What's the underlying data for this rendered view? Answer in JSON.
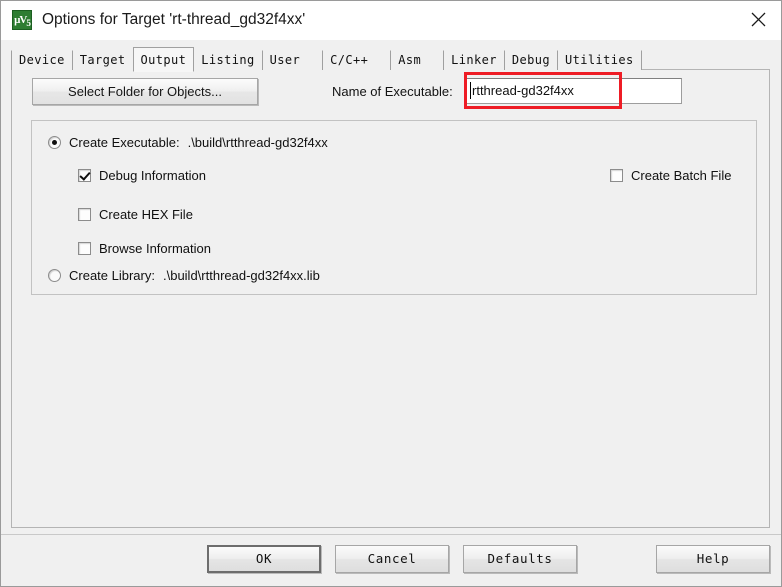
{
  "window": {
    "title": "Options for Target 'rt-thread_gd32f4xx'",
    "icon": "uvision-logo-icon",
    "close_label": "✕"
  },
  "tabs": [
    {
      "label": "Device",
      "selected": false
    },
    {
      "label": "Target",
      "selected": false
    },
    {
      "label": "Output",
      "selected": true
    },
    {
      "label": "Listing",
      "selected": false
    },
    {
      "label": "User",
      "selected": false
    },
    {
      "label": "C/C++",
      "selected": false
    },
    {
      "label": "Asm",
      "selected": false
    },
    {
      "label": "Linker",
      "selected": false
    },
    {
      "label": "Debug",
      "selected": false
    },
    {
      "label": "Utilities",
      "selected": false
    }
  ],
  "output_page": {
    "select_folder_button": "Select Folder for Objects...",
    "name_of_executable_label": "Name of Executable:",
    "name_of_executable_value": "rtthread-gd32f4xx",
    "highlight_color": "#ee1c25",
    "options": {
      "create_executable": {
        "label": "Create Executable:",
        "path": ".\\build\\rtthread-gd32f4xx",
        "checked": true
      },
      "debug_information": {
        "label": "Debug Information",
        "checked": true
      },
      "create_hex_file": {
        "label": "Create HEX File",
        "checked": false
      },
      "browse_information": {
        "label": "Browse Information",
        "checked": false
      },
      "create_batch_file": {
        "label": "Create Batch File",
        "checked": false
      },
      "create_library": {
        "label": "Create Library:",
        "path": ".\\build\\rtthread-gd32f4xx.lib",
        "checked": false
      }
    }
  },
  "footer": {
    "ok": "OK",
    "cancel": "Cancel",
    "defaults": "Defaults",
    "help": "Help"
  }
}
